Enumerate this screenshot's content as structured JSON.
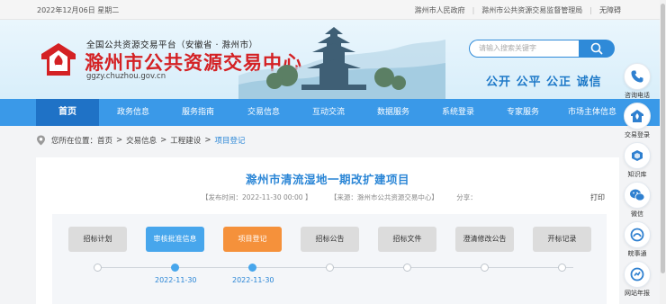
{
  "topbar": {
    "date": "2022年12月06日 星期二",
    "links": [
      "滁州市人民政府",
      "滁州市公共资源交易监督管理局",
      "无障碍"
    ]
  },
  "header": {
    "subtitle": "全国公共资源交易平台（安徽省 · 滁州市）",
    "site_name": "滁州市公共资源交易中心",
    "url": "ggzy.chuzhou.gov.cn",
    "search_placeholder": "请输入搜索关键字",
    "slogan": "公开  公平  公正  诚信"
  },
  "colors": {
    "brand_red": "#d42124",
    "nav_blue": "#3a99e8",
    "nav_active": "#1f72c6",
    "accent_blue": "#2b86d6",
    "step_done": "#47a6ec",
    "step_current": "#f5913b"
  },
  "nav": {
    "items": [
      {
        "label": "首页",
        "active": true
      },
      {
        "label": "政务信息"
      },
      {
        "label": "服务指南"
      },
      {
        "label": "交易信息"
      },
      {
        "label": "互动交流"
      },
      {
        "label": "数据服务"
      },
      {
        "label": "系统登录"
      },
      {
        "label": "专家服务"
      },
      {
        "label": "市场主体信息"
      }
    ]
  },
  "breadcrumb": {
    "prefix": "您所在位置：",
    "items": [
      "首页",
      "交易信息",
      "工程建设"
    ],
    "current": "项目登记"
  },
  "article": {
    "title": "滁州市清流湿地一期改扩建项目",
    "publish_time": "【发布时间：2022-11-30 00:00 】",
    "source": "【来源：滁州市公共资源交易中心】",
    "share": "分享：",
    "print": "打印"
  },
  "flow": {
    "steps": [
      {
        "label": "招标计划",
        "state": "pending",
        "date": ""
      },
      {
        "label": "审核批准信息",
        "state": "done",
        "date": "2022-11-30"
      },
      {
        "label": "项目登记",
        "state": "current",
        "date": "2022-11-30"
      },
      {
        "label": "招标公告",
        "state": "pending",
        "date": ""
      },
      {
        "label": "招标文件",
        "state": "pending",
        "date": ""
      },
      {
        "label": "澄清修改公告",
        "state": "pending",
        "date": ""
      },
      {
        "label": "开标记录",
        "state": "pending",
        "date": ""
      }
    ]
  },
  "sidebar": {
    "items": [
      {
        "label": "咨询电话",
        "icon": "phone-icon"
      },
      {
        "label": "交易登录",
        "icon": "logo-icon"
      },
      {
        "label": "知识库",
        "icon": "book-icon"
      },
      {
        "label": "微信",
        "icon": "wechat-icon"
      },
      {
        "label": "皖事通",
        "icon": "wanshitong-icon"
      },
      {
        "label": "网站年报",
        "icon": "report-icon"
      }
    ]
  }
}
